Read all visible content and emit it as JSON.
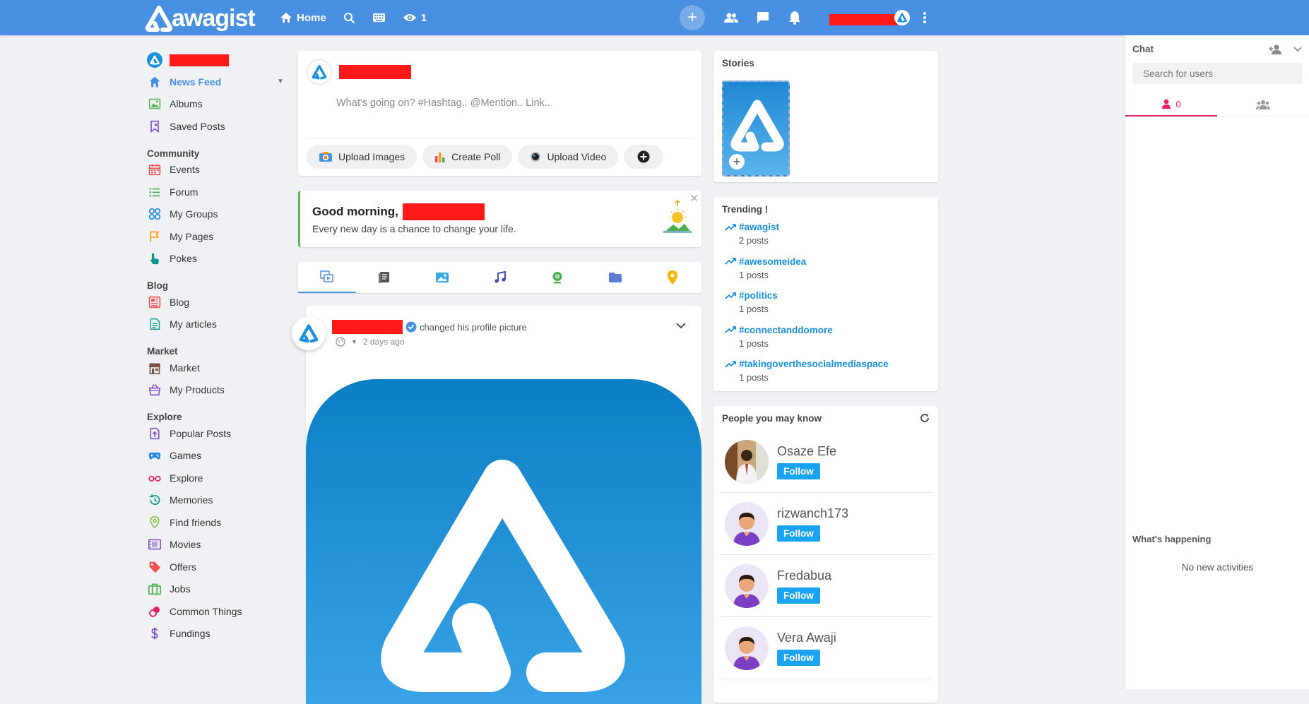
{
  "brand": {
    "name": "awagist",
    "accent": "#4a90e2"
  },
  "topbar": {
    "home_label": "Home",
    "views_count": "1"
  },
  "sidebar": {
    "items_main": [
      {
        "label": "News Feed",
        "icon": "home-icon",
        "color": "#4a90e2"
      },
      {
        "label": "Albums",
        "icon": "image-icon",
        "color": "#5cb85c"
      },
      {
        "label": "Saved Posts",
        "icon": "bookmark-icon",
        "color": "#7b4fd6"
      }
    ],
    "community_title": "Community",
    "community": [
      {
        "label": "Events",
        "icon": "calendar-icon",
        "color": "#f05050"
      },
      {
        "label": "Forum",
        "icon": "list-icon",
        "color": "#4caf50"
      },
      {
        "label": "My Groups",
        "icon": "groups-icon",
        "color": "#1e88e5"
      },
      {
        "label": "My Pages",
        "icon": "flag-icon",
        "color": "#ff9800"
      },
      {
        "label": "Pokes",
        "icon": "hand-icon",
        "color": "#009688"
      }
    ],
    "blog_title": "Blog",
    "blog": [
      {
        "label": "Blog",
        "icon": "blog-icon",
        "color": "#f05050"
      },
      {
        "label": "My articles",
        "icon": "article-icon",
        "color": "#26a69a"
      }
    ],
    "market_title": "Market",
    "market": [
      {
        "label": "Market",
        "icon": "store-icon",
        "color": "#795548"
      },
      {
        "label": "My Products",
        "icon": "basket-icon",
        "color": "#7e57c2"
      }
    ],
    "explore_title": "Explore",
    "explore": [
      {
        "label": "Popular Posts",
        "icon": "upload-icon",
        "color": "#7e57c2"
      },
      {
        "label": "Games",
        "icon": "gamepad-icon",
        "color": "#1e88e5"
      },
      {
        "label": "Explore",
        "icon": "glasses-icon",
        "color": "#e91e63"
      },
      {
        "label": "Memories",
        "icon": "history-icon",
        "color": "#009688"
      },
      {
        "label": "Find friends",
        "icon": "location-icon",
        "color": "#8bc34a"
      },
      {
        "label": "Movies",
        "icon": "film-icon",
        "color": "#7e57c2"
      },
      {
        "label": "Offers",
        "icon": "tag-icon",
        "color": "#f05050"
      },
      {
        "label": "Jobs",
        "icon": "briefcase-icon",
        "color": "#4caf50"
      },
      {
        "label": "Common Things",
        "icon": "rings-icon",
        "color": "#e91e63"
      },
      {
        "label": "Fundings",
        "icon": "dollar-icon",
        "color": "#7e57c2"
      }
    ]
  },
  "composer": {
    "placeholder": "What's going on? #Hashtag.. @Mention.. Link..",
    "upload_images": "Upload Images",
    "create_poll": "Create Poll",
    "upload_video": "Upload Video"
  },
  "greeting": {
    "title": "Good morning,",
    "message": "Every new day is a chance to change your life."
  },
  "post": {
    "action": "changed his profile picture",
    "time": "2 days ago"
  },
  "stories": {
    "title": "Stories"
  },
  "trending": {
    "title": "Trending !",
    "items": [
      {
        "tag": "#awagist",
        "count": "2 posts"
      },
      {
        "tag": "#awesomeidea",
        "count": "1 posts"
      },
      {
        "tag": "#politics",
        "count": "1 posts"
      },
      {
        "tag": "#connectanddomore",
        "count": "1 posts"
      },
      {
        "tag": "#takingoverthesocialmediaspace",
        "count": "1 posts"
      }
    ]
  },
  "people": {
    "title": "People you may know",
    "follow_label": "Follow",
    "list": [
      {
        "name": "Osaze Efe"
      },
      {
        "name": "rizwanch173"
      },
      {
        "name": "Fredabua"
      },
      {
        "name": "Vera Awaji"
      }
    ]
  },
  "chat": {
    "title": "Chat",
    "search_placeholder": "Search for users",
    "online_count": "0",
    "whats_happening": "What's happening",
    "no_activities": "No new activities"
  }
}
